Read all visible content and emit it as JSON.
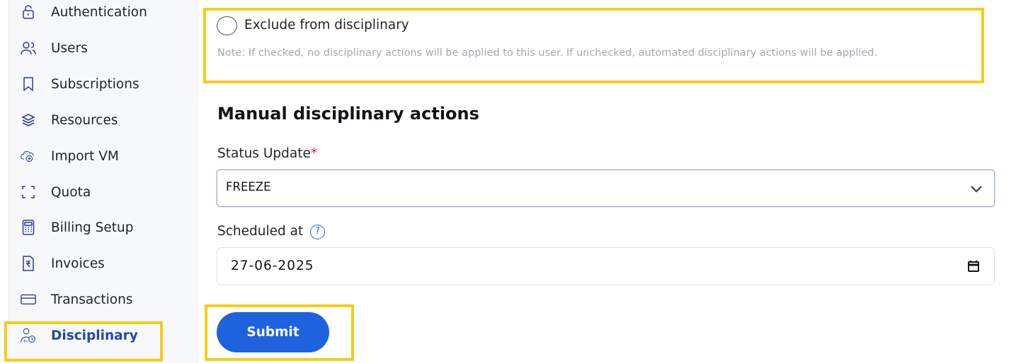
{
  "sidebar": {
    "items": [
      {
        "label": "Authentication",
        "icon": "lock-icon"
      },
      {
        "label": "Users",
        "icon": "users-icon"
      },
      {
        "label": "Subscriptions",
        "icon": "bookmark-icon"
      },
      {
        "label": "Resources",
        "icon": "layers-icon"
      },
      {
        "label": "Import VM",
        "icon": "cloud-add-icon"
      },
      {
        "label": "Quota",
        "icon": "frame-icon"
      },
      {
        "label": "Billing Setup",
        "icon": "calculator-icon"
      },
      {
        "label": "Invoices",
        "icon": "rupee-document-icon"
      },
      {
        "label": "Transactions",
        "icon": "card-icon"
      },
      {
        "label": "Disciplinary",
        "icon": "user-clock-icon",
        "active": true
      }
    ]
  },
  "form": {
    "exclude_label": "Exclude from disciplinary",
    "exclude_checked": false,
    "note": "Note: If checked, no disciplinary actions will be applied to this user. If unchecked, automated disciplinary actions will be applied.",
    "section_title": "Manual disciplinary actions",
    "status_label": "Status Update",
    "required_mark": "*",
    "status_value": "FREEZE",
    "scheduled_label": "Scheduled at",
    "help_glyph": "?",
    "scheduled_value": "27-06-2025",
    "submit_label": "Submit"
  },
  "colors": {
    "highlight": "#f6cd16",
    "accent": "#1e63dd",
    "active_nav": "#2447a6"
  }
}
